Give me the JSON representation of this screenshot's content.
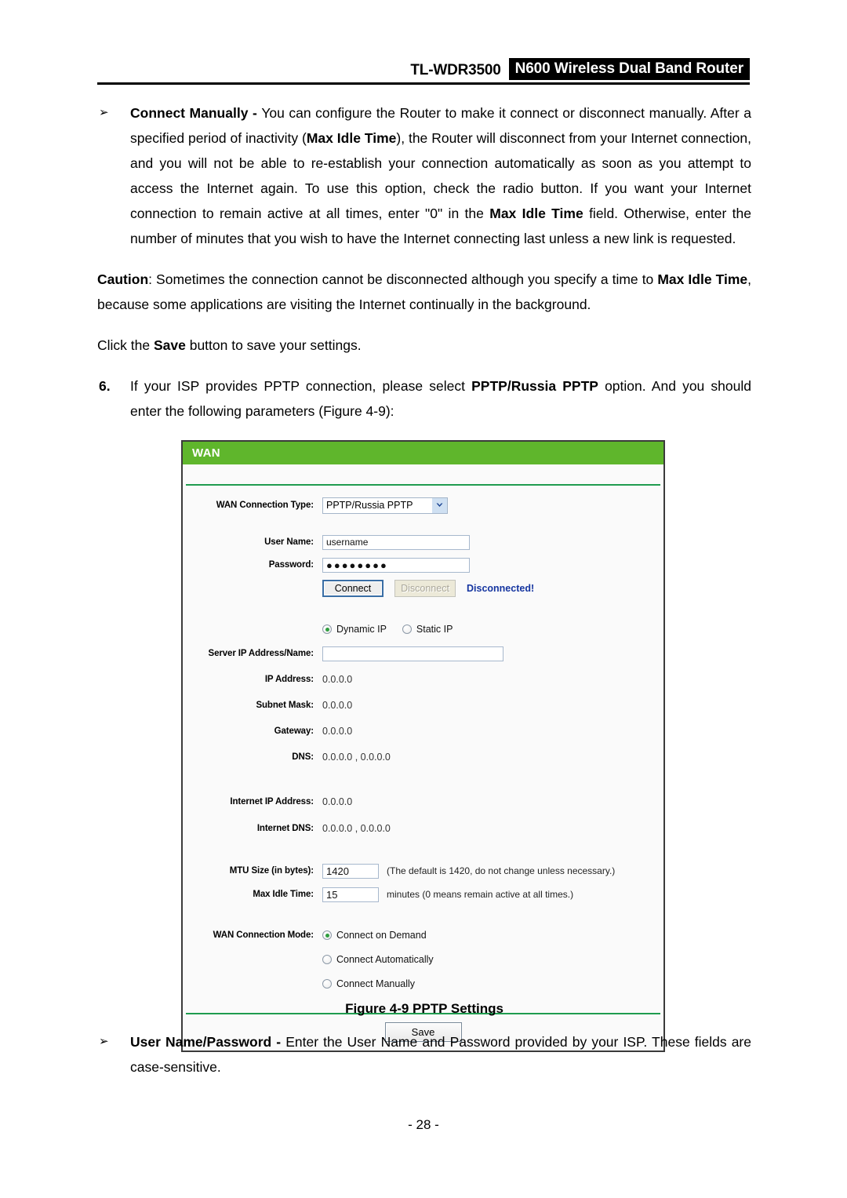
{
  "header": {
    "model": "TL-WDR3500",
    "product_badge": "N600 Wireless Dual Band Router"
  },
  "body_text": {
    "bullet_marker": "➢",
    "connect_manually_title": "Connect Manually - ",
    "connect_manually_p1": "You can configure the Router to make it connect or disconnect manually. After a specified period of inactivity (",
    "connect_manually_b1": "Max Idle Time",
    "connect_manually_p2": "), the Router will disconnect from your Internet connection, and you will not be able to re-establish your connection automatically as soon as you attempt to access the Internet again. To use this option, check the radio button. If you want your Internet connection to remain active at all times, enter \"0\" in the ",
    "connect_manually_b2": "Max Idle Time",
    "connect_manually_p3": " field. Otherwise, enter the number of minutes that you wish to have the Internet connecting last unless a new link is requested.",
    "caution_label": "Caution",
    "caution_p1": ": Sometimes the connection cannot be disconnected although you specify a time to ",
    "caution_b1": "Max Idle Time",
    "caution_p2": ", because some applications are visiting the Internet continually in the background.",
    "save_hint_p1": "Click the ",
    "save_hint_b1": "Save",
    "save_hint_p2": " button to save your settings.",
    "step6_number": "6.",
    "step6_p1": "If your ISP provides PPTP connection, please select ",
    "step6_b1": "PPTP/Russia PPTP",
    "step6_p2": " option. And you should enter the following parameters (Figure 4-9):",
    "figure_caption": "Figure 4-9 PPTP Settings",
    "userpass_title": "User Name/Password - ",
    "userpass_p1": "Enter the User Name and Password provided by your ISP. These fields are case-sensitive.",
    "page_number": "- 28 -"
  },
  "wan_panel": {
    "title": "WAN",
    "connection_type": {
      "label": "WAN Connection Type:",
      "value": "PPTP/Russia PPTP",
      "arrow": "▼"
    },
    "user_name": {
      "label": "User Name:",
      "value": "username"
    },
    "password": {
      "label": "Password:",
      "value": "●●●●●●●●"
    },
    "connect_button": "Connect",
    "disconnect_button": "Disconnect",
    "connection_status": "Disconnected!",
    "ip_mode": {
      "options": [
        "Dynamic IP",
        "Static IP"
      ],
      "selected": "Dynamic IP"
    },
    "server_ip": {
      "label": "Server IP Address/Name:",
      "value": ""
    },
    "readouts": [
      {
        "label": "IP Address:",
        "value": "0.0.0.0"
      },
      {
        "label": "Subnet Mask:",
        "value": "0.0.0.0"
      },
      {
        "label": "Gateway:",
        "value": "0.0.0.0"
      },
      {
        "label": "DNS:",
        "value": "0.0.0.0 , 0.0.0.0"
      }
    ],
    "internet_readouts": [
      {
        "label": "Internet IP Address:",
        "value": "0.0.0.0"
      },
      {
        "label": "Internet DNS:",
        "value": "0.0.0.0 , 0.0.0.0"
      }
    ],
    "mtu": {
      "label": "MTU Size (in bytes):",
      "value": "1420",
      "hint": "(The default is 1420, do not change unless necessary.)"
    },
    "max_idle": {
      "label": "Max Idle Time:",
      "value": "15",
      "hint": "minutes (0 means remain active at all times.)"
    },
    "connection_mode": {
      "label": "WAN Connection Mode:",
      "options": [
        "Connect on Demand",
        "Connect Automatically",
        "Connect Manually"
      ],
      "selected": "Connect on Demand"
    },
    "save_button": "Save"
  },
  "colors": {
    "panel_title_green": "#5fb62c",
    "rule_green": "#1f9c4f",
    "status_blue": "#1535a0",
    "radio_dot_green": "#2f9e3f"
  }
}
